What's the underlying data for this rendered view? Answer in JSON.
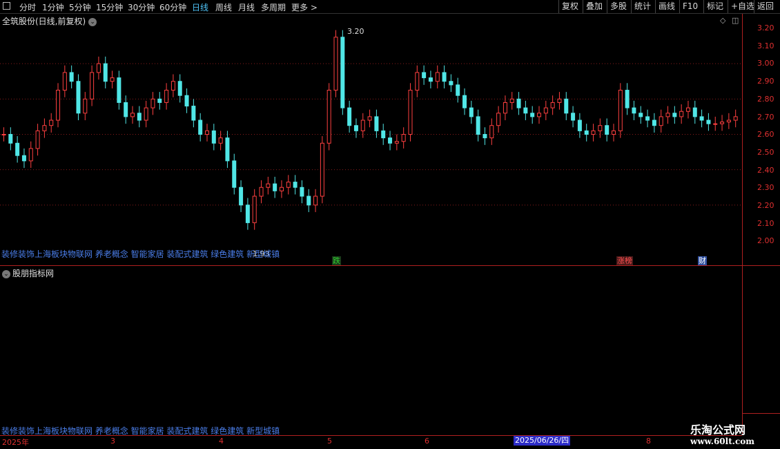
{
  "toolbar": {
    "periods": [
      "分时",
      "1分钟",
      "5分钟",
      "15分钟",
      "30分钟",
      "60分钟",
      "日线",
      "周线",
      "月线",
      "多周期",
      "更多 >"
    ],
    "active_period": "日线",
    "right_buttons": [
      "复权",
      "叠加",
      "多股",
      "统计",
      "画线",
      "F10",
      "标记",
      "+自选",
      "返回"
    ]
  },
  "main": {
    "title": "全筑股份(日线,前复权)",
    "price_labels": [
      "3.20",
      "3.10",
      "3.00",
      "2.90",
      "2.80",
      "2.70",
      "2.60",
      "2.50",
      "2.40",
      "2.30",
      "2.20",
      "2.10",
      "2.00"
    ],
    "high_label": "3.20",
    "low_label": "1.93",
    "concepts": "装修装饰上海板块物联网 养老概念 智能家居 装配式建筑 绿色建筑 新型城镇",
    "markers": [
      {
        "text": "跌",
        "color": "#30d030",
        "bg": "#1a3a1a"
      },
      {
        "text": "涨榜",
        "color": "#ff5050",
        "bg": "#4a1a1a"
      },
      {
        "text": "财",
        "color": "#ffffff",
        "bg": "#3050a0"
      }
    ],
    "colors": {
      "up": "#ff4040",
      "down": "#50e6e6",
      "grid": "#8a1c1c"
    }
  },
  "indicator": {
    "title": "股朋指标网",
    "concepts": "装修装饰上海板块物联网 养老概念 智能家居 装配式建筑 绿色建筑 新型城镇"
  },
  "date_axis": {
    "labels": [
      "2025年",
      "3",
      "4",
      "5",
      "6",
      "8"
    ],
    "cursor_date": "2025/06/26/四"
  },
  "watermark": {
    "title": "乐淘公式网",
    "url": "www.60lt.com"
  }
}
